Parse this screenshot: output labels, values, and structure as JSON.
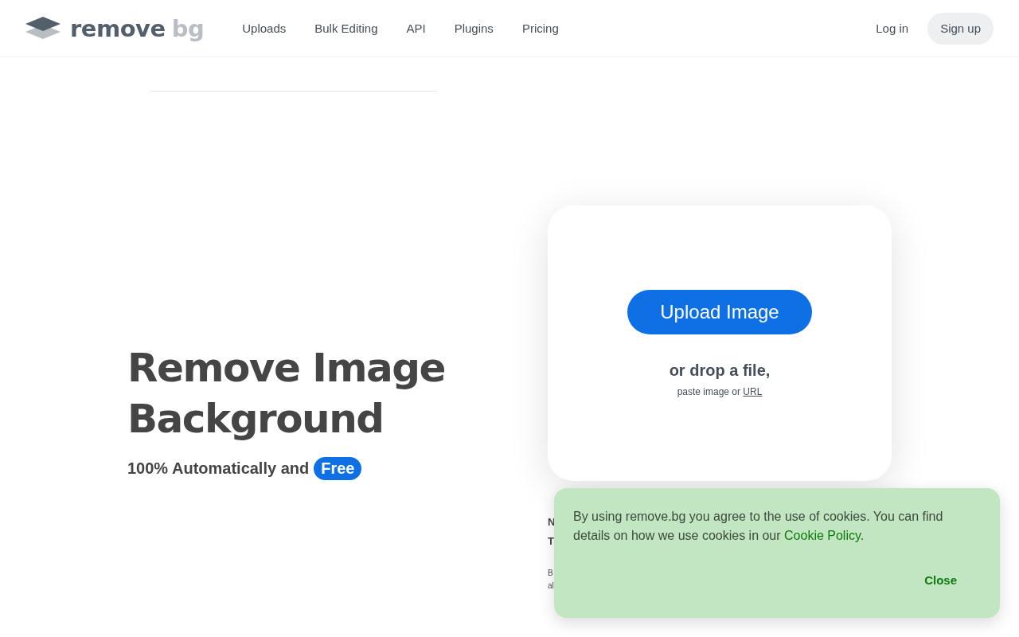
{
  "header": {
    "logo": {
      "word": "remove",
      "suffix": "bg"
    },
    "nav": [
      "Uploads",
      "Bulk Editing",
      "API",
      "Plugins",
      "Pricing"
    ],
    "login": "Log in",
    "signup": "Sign up"
  },
  "hero": {
    "title_lines": [
      "Remove Image",
      "Background"
    ],
    "subtitle": "100% Automatically and",
    "badge": "Free"
  },
  "upload": {
    "button": "Upload Image",
    "drop": "or drop a file,",
    "paste": "paste image or",
    "url": "URL"
  },
  "hidden_section": {
    "heading_lines": [
      "N",
      "T"
    ],
    "text_lines": [
      "B",
      "al"
    ]
  },
  "cookie_banner": {
    "text": "By using remove.bg you agree to the use of cookies. You can find details on how we use cookies in our",
    "link": "Cookie Policy",
    "after": ".",
    "close": "Close"
  }
}
